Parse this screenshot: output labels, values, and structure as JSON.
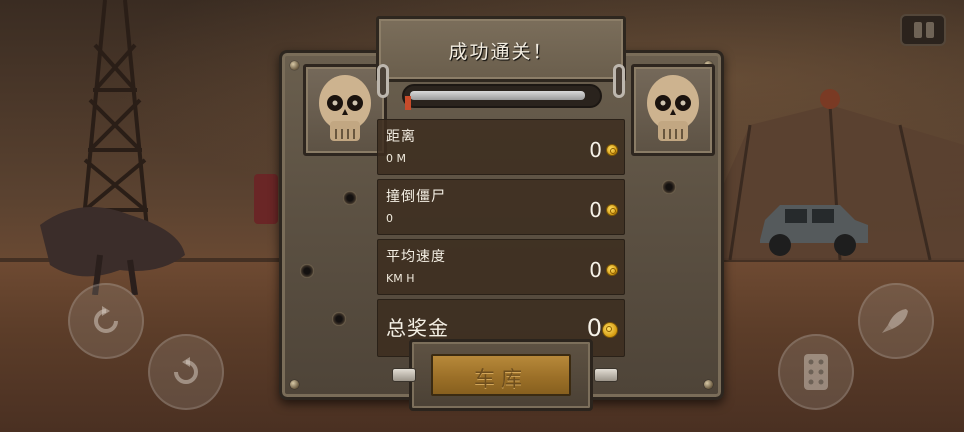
{
  "title": "成功通关！",
  "progress": {
    "fraction": 0.95
  },
  "stats": [
    {
      "label": "距离",
      "sub": "0 M",
      "value": "0",
      "icon": "coin-icon"
    },
    {
      "label": "撞倒僵尸",
      "sub": "0",
      "value": "0",
      "icon": "coin-icon"
    },
    {
      "label": "平均速度",
      "sub": "KM H",
      "value": "0",
      "icon": "coin-icon"
    }
  ],
  "total": {
    "label": "总奖金",
    "value": "0",
    "icon": "coin-icon"
  },
  "garage_button": {
    "label": "车库"
  },
  "controls": {
    "left": [
      "rotate-back-icon",
      "rotate-forward-icon"
    ],
    "right": [
      "rocket-icon",
      "gas-pedal-icon"
    ],
    "pause": "pause-icon"
  },
  "colors": {
    "accent_gold": "#b7893a",
    "panel": "#5b5042",
    "coin": "#ffd23a"
  }
}
